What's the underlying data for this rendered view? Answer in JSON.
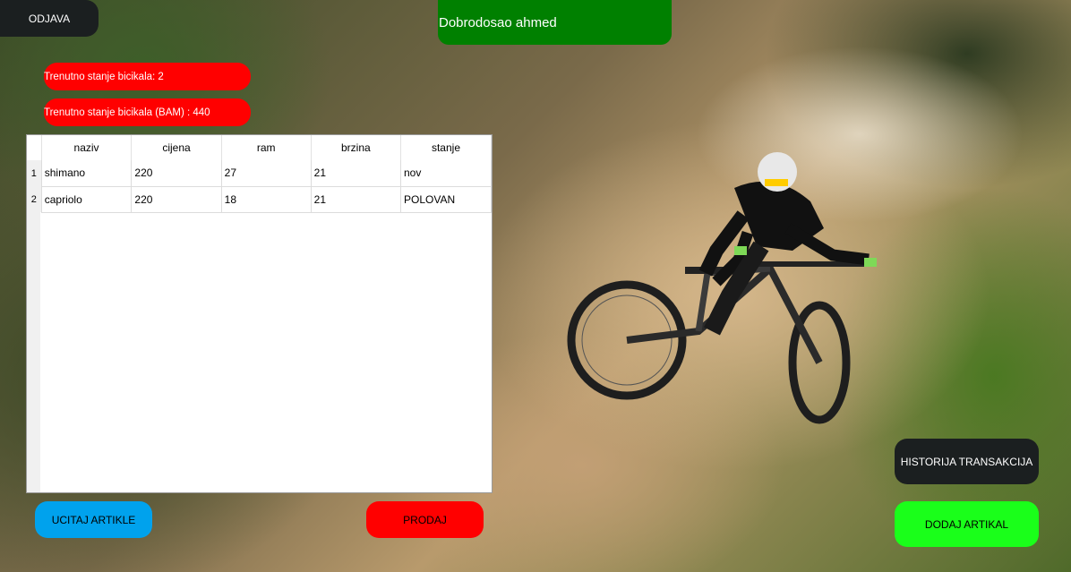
{
  "header": {
    "logout_label": "ODJAVA",
    "welcome_text": "Dobrodosao ahmed"
  },
  "stats": {
    "bike_count": "Trenutno stanje bicikala: 2",
    "bike_value": "Trenutno stanje bicikala (BAM) : 440"
  },
  "table": {
    "columns": [
      "naziv",
      "cijena",
      "ram",
      "brzina",
      "stanje"
    ],
    "rows": [
      {
        "num": "1",
        "naziv": "shimano",
        "cijena": "220",
        "ram": "27",
        "brzina": "21",
        "stanje": "nov"
      },
      {
        "num": "2",
        "naziv": "capriolo",
        "cijena": "220",
        "ram": "18",
        "brzina": "21",
        "stanje": "POLOVAN"
      }
    ]
  },
  "actions": {
    "load_label": "UCITAJ ARTIKLE",
    "sell_label": "PRODAJ",
    "history_label": "HISTORIJA TRANSAKCIJA",
    "add_label": "DODAJ ARTIKAL"
  },
  "colors": {
    "welcome": "#008000",
    "stat_pill": "#ff0000",
    "load_button": "#00a2ed",
    "sell_button": "#ff0000",
    "history_button": "#1b1f20",
    "add_button": "#1aff1a"
  }
}
